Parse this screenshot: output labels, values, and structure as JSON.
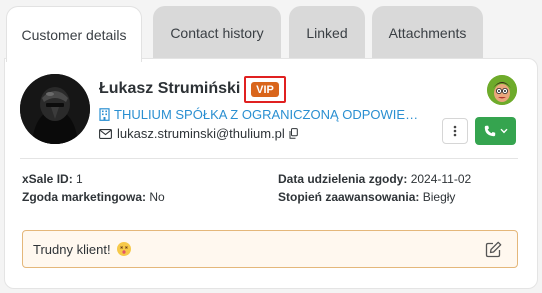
{
  "tabs": [
    {
      "label": "Customer details",
      "active": true
    },
    {
      "label": "Contact history",
      "active": false
    },
    {
      "label": "Linked",
      "active": false
    },
    {
      "label": "Attachments",
      "active": false
    }
  ],
  "customer": {
    "name": "Łukasz Strumiński",
    "badge": "VIP",
    "company": "THULIUM SPÓŁKA Z OGRANICZONĄ ODPOWIEDZIALNOŚCIĄ",
    "email": "lukasz.struminski@thulium.pl"
  },
  "fields": {
    "xsale_label": "xSale ID:",
    "xsale_value": "1",
    "marketing_label": "Zgoda marketingowa:",
    "marketing_value": "No",
    "consent_date_label": "Data udzielenia zgody:",
    "consent_date_value": "2024-11-02",
    "level_label": "Stopień zaawansowania:",
    "level_value": "Biegły"
  },
  "note": {
    "text": "Trudny klient!"
  },
  "icons": {
    "company": "building-icon",
    "email": "envelope-icon",
    "copy": "copy-icon",
    "more": "vertical-dots-icon",
    "call": "phone-icon",
    "dropdown": "chevron-down-icon",
    "edit": "pencil-square-icon",
    "emoji": "dizzy-face-emoji"
  },
  "colors": {
    "accent_link": "#2a8fd1",
    "vip_badge": "#d9651b",
    "highlight_border": "#e02020",
    "call_button": "#35a44f",
    "note_border": "#e4b77a"
  }
}
